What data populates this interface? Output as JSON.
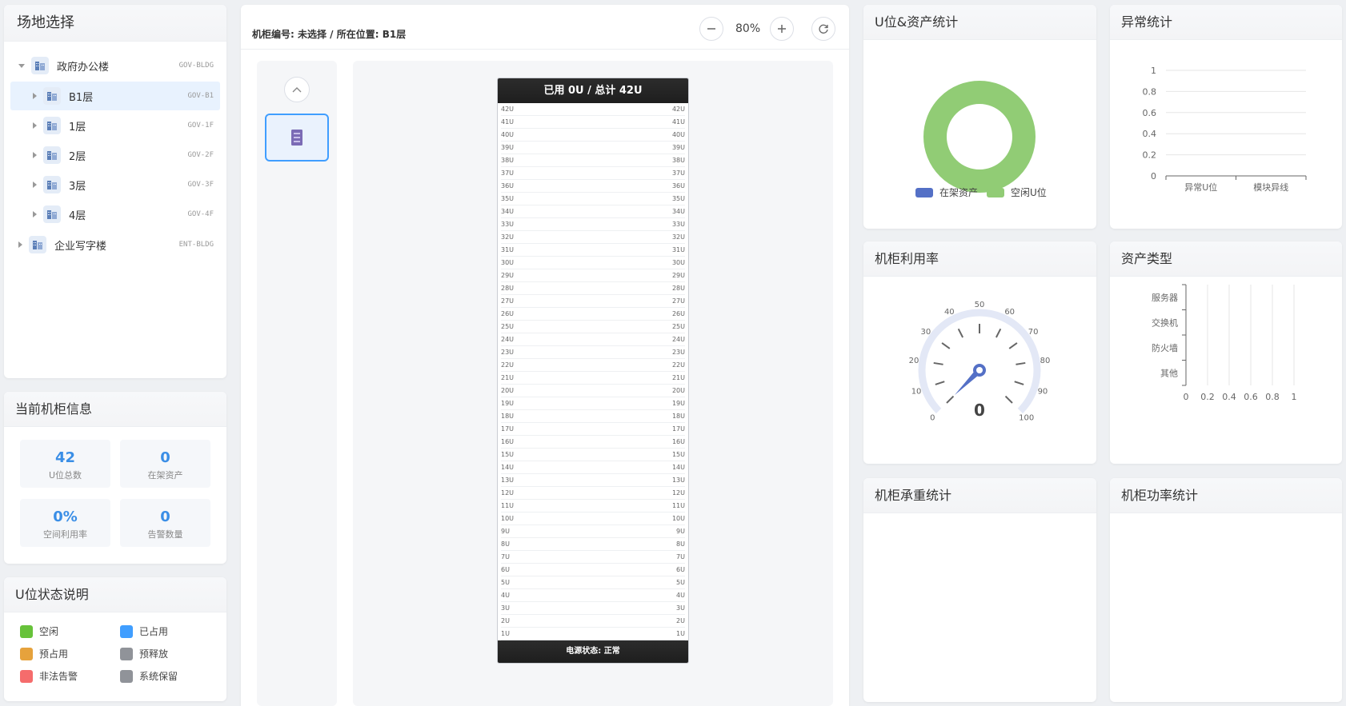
{
  "site_panel": {
    "title": "场地选择",
    "tree": [
      {
        "label": "政府办公楼",
        "code": "GOV-BLDG",
        "level": 0,
        "expanded": true
      },
      {
        "label": "B1层",
        "code": "GOV-B1",
        "level": 1,
        "active": true
      },
      {
        "label": "1层",
        "code": "GOV-1F",
        "level": 1
      },
      {
        "label": "2层",
        "code": "GOV-2F",
        "level": 1
      },
      {
        "label": "3层",
        "code": "GOV-3F",
        "level": 1
      },
      {
        "label": "4层",
        "code": "GOV-4F",
        "level": 1
      },
      {
        "label": "企业写字楼",
        "code": "ENT-BLDG",
        "level": 0,
        "expanded": false
      }
    ]
  },
  "cabinet_info": {
    "title": "当前机柜信息",
    "tiles": [
      {
        "value": "42",
        "label": "U位总数"
      },
      {
        "value": "0",
        "label": "在架资产"
      },
      {
        "value": "0%",
        "label": "空间利用率"
      },
      {
        "value": "0",
        "label": "告警数量"
      }
    ]
  },
  "u_status": {
    "title": "U位状态说明",
    "items": [
      {
        "label": "空闲",
        "color": "#67c23a"
      },
      {
        "label": "已占用",
        "color": "#409eff"
      },
      {
        "label": "预占用",
        "color": "#e6a23c"
      },
      {
        "label": "预释放",
        "color": "#909399"
      },
      {
        "label": "非法告警",
        "color": "#f56c6c"
      },
      {
        "label": "系统保留",
        "color": "#909399"
      }
    ]
  },
  "toolbar": {
    "cabinet_label": "机柜编号: 未选择 / 所在位置: B1层",
    "zoom": "80%"
  },
  "rack": {
    "header": "已用 0U / 总计 42U",
    "footer": "电源状态: 正常",
    "total_u": 42
  },
  "u_asset_stats": {
    "title": "U位&资产统计",
    "legend": [
      {
        "label": "在架资产",
        "color": "#5470c6",
        "value": 0
      },
      {
        "label": "空闲U位",
        "color": "#91cc75",
        "value": 42
      }
    ]
  },
  "anomaly_stats": {
    "title": "异常统计"
  },
  "cabinet_util": {
    "title": "机柜利用率",
    "value": "0",
    "ticks": [
      "0",
      "10",
      "20",
      "30",
      "40",
      "50",
      "60",
      "70",
      "80",
      "90",
      "100"
    ]
  },
  "asset_type": {
    "title": "资产类型"
  },
  "weight_stats": {
    "title": "机柜承重统计"
  },
  "power_stats": {
    "title": "机柜功率统计"
  },
  "chart_data": [
    {
      "type": "pie",
      "title": "U位&资产统计",
      "categories": [
        "在架资产",
        "空闲U位"
      ],
      "values": [
        0,
        42
      ],
      "legend": "bottom"
    },
    {
      "type": "bar",
      "title": "异常统计",
      "categories": [
        "异常U位",
        "模块异线"
      ],
      "values": [
        0,
        0
      ],
      "yticks": [
        "0",
        "0.2",
        "0.4",
        "0.6",
        "0.8",
        "1"
      ],
      "ylim": [
        0,
        1
      ],
      "grid": true
    },
    {
      "type": "bar",
      "orientation": "horizontal",
      "title": "资产类型",
      "categories": [
        "服务器",
        "交换机",
        "防火墙",
        "其他"
      ],
      "values": [
        0,
        0,
        0,
        0
      ],
      "xticks": [
        "0",
        "0.2",
        "0.4",
        "0.6",
        "0.8",
        "1"
      ],
      "xlim": [
        0,
        1
      ],
      "grid": true
    }
  ]
}
